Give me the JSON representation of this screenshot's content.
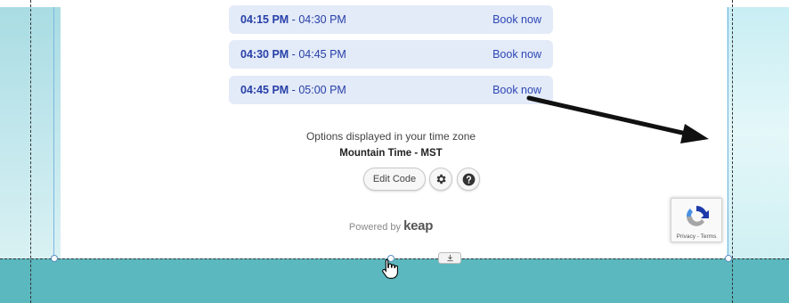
{
  "time_slots": [
    {
      "start": "04:15 PM",
      "end": "04:30 PM",
      "book_label": "Book now"
    },
    {
      "start": "04:30 PM",
      "end": "04:45 PM",
      "book_label": "Book now"
    },
    {
      "start": "04:45 PM",
      "end": "05:00 PM",
      "book_label": "Book now"
    }
  ],
  "timezone": {
    "note": "Options displayed in your time zone",
    "name": "Mountain Time - MST"
  },
  "toolbar": {
    "edit_code_label": "Edit Code",
    "settings_icon": "gear-icon",
    "help_icon": "question-icon"
  },
  "footer": {
    "powered_by": "Powered by",
    "brand": "keap"
  },
  "recaptcha": {
    "terms": "Privacy - Terms"
  },
  "colors": {
    "slot_bg": "#e3eaf8",
    "slot_text": "#2740a8",
    "teal_band": "#5bb8be"
  }
}
